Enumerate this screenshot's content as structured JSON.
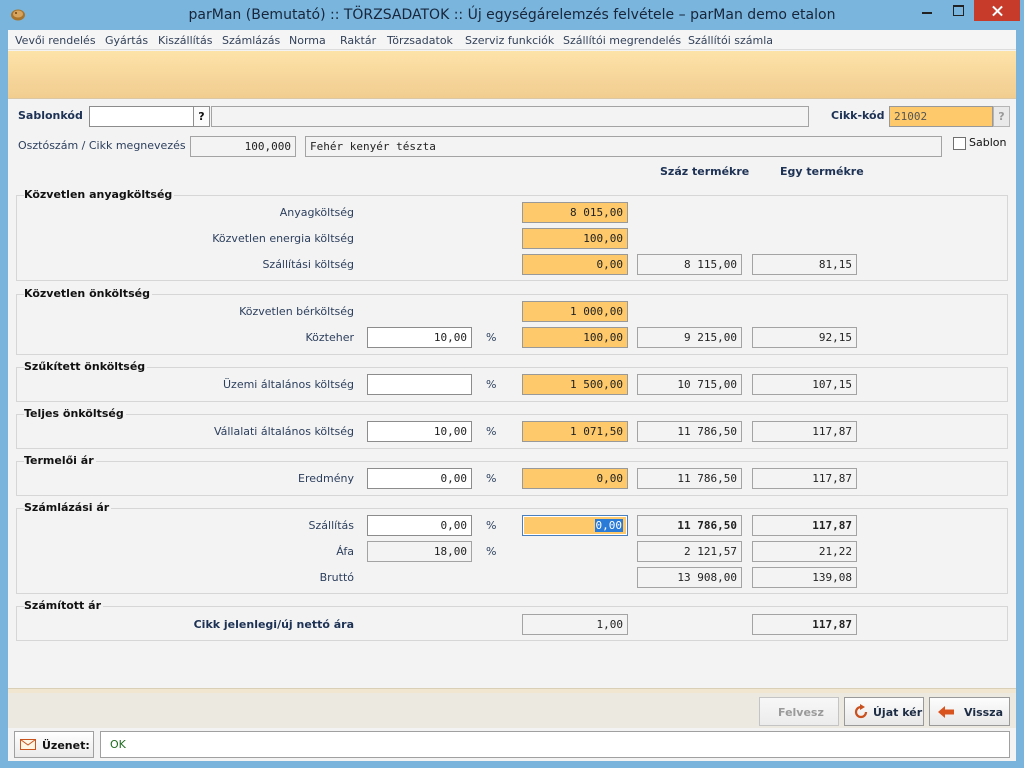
{
  "window": {
    "title": "parMan (Bemutató) :: TÖRZSADATOK :: Új egységárelemzés felvétele   –   parMan demo etalon"
  },
  "menu": {
    "items": [
      "Vevői rendelés",
      "Gyártás",
      "Kiszállítás",
      "Számlázás",
      "Norma",
      "Raktár",
      "Törzsadatok",
      "Szerviz funkciók",
      "Szállítói megrendelés",
      "Szállítói számla"
    ]
  },
  "header": {
    "sablonkod_label": "Sablonkód",
    "sablonkod_value": "",
    "sablonkod_desc": "",
    "lookup_glyph": "?",
    "cikkkod_label": "Cikk-kód",
    "cikkkod_value": "21002",
    "oszto_label": "Osztószám / Cikk megnevezés",
    "oszto_value": "100,000",
    "cikk_megnevezes": "Fehér kenyér tészta",
    "sablon_checkbox_label": "Sablon",
    "sablon_checked": false,
    "col_szaz": "Száz termékre",
    "col_egy": "Egy termékre"
  },
  "sections": {
    "anyag": {
      "title": "Közvetlen anyagköltség",
      "anyagkoltseg_label": "Anyagköltség",
      "anyagkoltseg_value": "8 015,00",
      "energia_label": "Közvetlen energia költség",
      "energia_value": "100,00",
      "szallitasi_label": "Szállítási költség",
      "szallitasi_value": "0,00",
      "szaz": "8 115,00",
      "egy": "81,15"
    },
    "onkoltseg": {
      "title": "Közvetlen önköltség",
      "berkoltseg_label": "Közvetlen bérköltség",
      "berkoltseg_value": "1 000,00",
      "kozteher_label": "Közteher",
      "kozteher_pct": "10,00",
      "kozteher_value": "100,00",
      "szaz": "9 215,00",
      "egy": "92,15"
    },
    "szukitett": {
      "title": "Szűkített önköltség",
      "uzemi_label": "Üzemi általános költség",
      "uzemi_pct": "",
      "uzemi_value": "1 500,00",
      "szaz": "10 715,00",
      "egy": "107,15"
    },
    "teljes": {
      "title": "Teljes önköltség",
      "vallalati_label": "Vállalati általános költség",
      "vallalati_pct": "10,00",
      "vallalati_value": "1 071,50",
      "szaz": "11 786,50",
      "egy": "117,87"
    },
    "termeloi": {
      "title": "Termelői ár",
      "eredmeny_label": "Eredmény",
      "eredmeny_pct": "0,00",
      "eredmeny_value": "0,00",
      "szaz": "11 786,50",
      "egy": "117,87"
    },
    "szamlazasi": {
      "title": "Számlázási ár",
      "szallitas_label": "Szállítás",
      "szallitas_pct": "0,00",
      "szallitas_value": "0,00",
      "szallitas_szaz": "11 786,50",
      "szallitas_egy": "117,87",
      "afa_label": "Áfa",
      "afa_pct": "18,00",
      "afa_szaz": "2 121,57",
      "afa_egy": "21,22",
      "brutto_label": "Bruttó",
      "brutto_szaz": "13 908,00",
      "brutto_egy": "139,08"
    },
    "szamitott": {
      "title": "Számított ár",
      "netto_label": "Cikk jelenlegi/új nettó ára",
      "netto_value": "1,00",
      "netto_egy": "117,87"
    }
  },
  "percent_sign": "%",
  "buttons": {
    "felvesz": "Felvesz",
    "ujat_ker": "Újat kér",
    "vissza": "Vissza"
  },
  "status": {
    "label": "Üzenet:",
    "message": "OK"
  },
  "colors": {
    "titlebar": "#79b5dd",
    "band": "#f6d59a",
    "input_orange": "#fdc96a",
    "close_red": "#c73b2b",
    "status_ok": "#1f6b1f"
  }
}
